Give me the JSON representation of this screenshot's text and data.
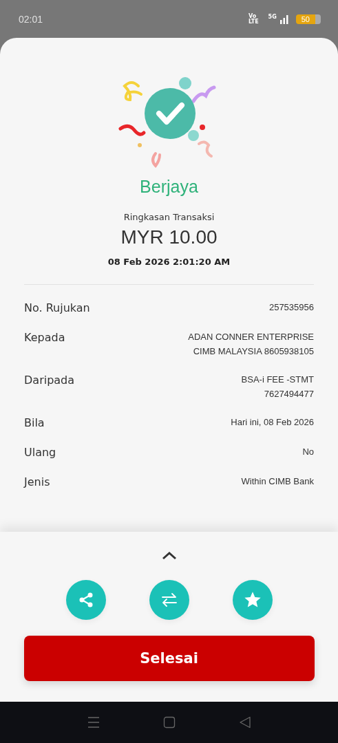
{
  "status_bar": {
    "time": "02:01",
    "network_top": "Vo",
    "network_bottom": "LTE",
    "signal_label": "5G",
    "battery": "50"
  },
  "result": {
    "status": "Berjaya",
    "summary_title": "Ringkasan Transaksi",
    "amount": "MYR 10.00",
    "datetime": "08 Feb 2026 2:01:20 AM"
  },
  "details": [
    {
      "label": "No. Rujukan",
      "lines": [
        "257535956"
      ]
    },
    {
      "label": "Kepada",
      "lines": [
        "ADAN CONNER ENTERPRISE",
        "CIMB MALAYSIA 8605938105"
      ]
    },
    {
      "label": "Daripada",
      "lines": [
        "BSA-i FEE -STMT",
        "7627494477"
      ]
    },
    {
      "label": "Bila",
      "lines": [
        "Hari ini, 08 Feb 2026"
      ]
    },
    {
      "label": "Ulang",
      "lines": [
        "No"
      ]
    },
    {
      "label": "Jenis",
      "lines": [
        "Within CIMB Bank"
      ]
    }
  ],
  "actions": [
    {
      "kind": "share"
    },
    {
      "kind": "transfer"
    },
    {
      "kind": "favourite"
    }
  ],
  "done_button": "Selesai"
}
